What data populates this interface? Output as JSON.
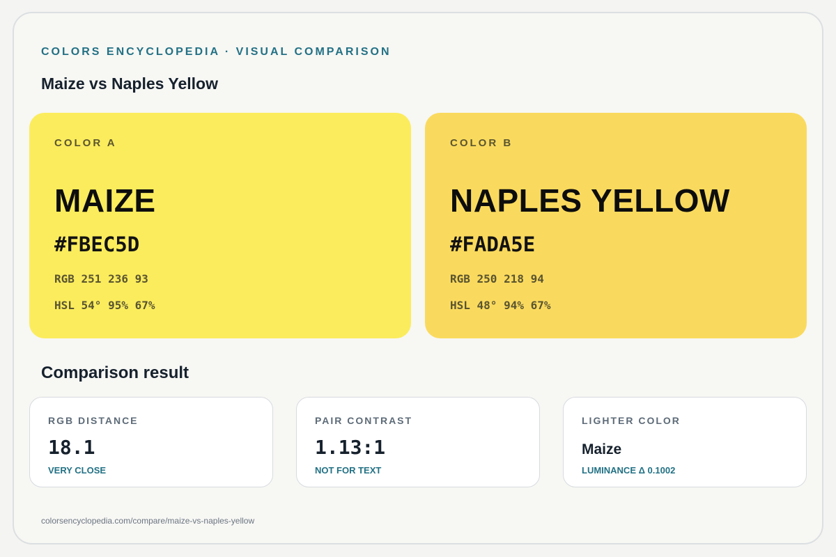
{
  "header": {
    "eyebrow": "COLORS ENCYCLOPEDIA · VISUAL COMPARISON",
    "title": "Maize vs Naples Yellow"
  },
  "colors": {
    "accent": "#227184",
    "a": {
      "tag": "COLOR A",
      "name": "MAIZE",
      "hex": "#FBEC5D",
      "rgb": "RGB 251 236 93",
      "hsl": "HSL 54° 95% 67%",
      "swatch": "#fbec5d"
    },
    "b": {
      "tag": "COLOR B",
      "name": "NAPLES YELLOW",
      "hex": "#FADA5E",
      "rgb": "RGB 250 218 94",
      "hsl": "HSL 48° 94% 67%",
      "swatch": "#fada5e"
    }
  },
  "comparison": {
    "title": "Comparison result",
    "metrics": [
      {
        "label": "RGB DISTANCE",
        "value": "18.1",
        "note": "VERY CLOSE"
      },
      {
        "label": "PAIR CONTRAST",
        "value": "1.13:1",
        "note": "NOT FOR TEXT"
      },
      {
        "label": "LIGHTER COLOR",
        "value": "Maize",
        "note": "LUMINANCE Δ 0.1002"
      }
    ]
  },
  "footer": {
    "url": "colorsencyclopedia.com/compare/maize-vs-naples-yellow"
  }
}
